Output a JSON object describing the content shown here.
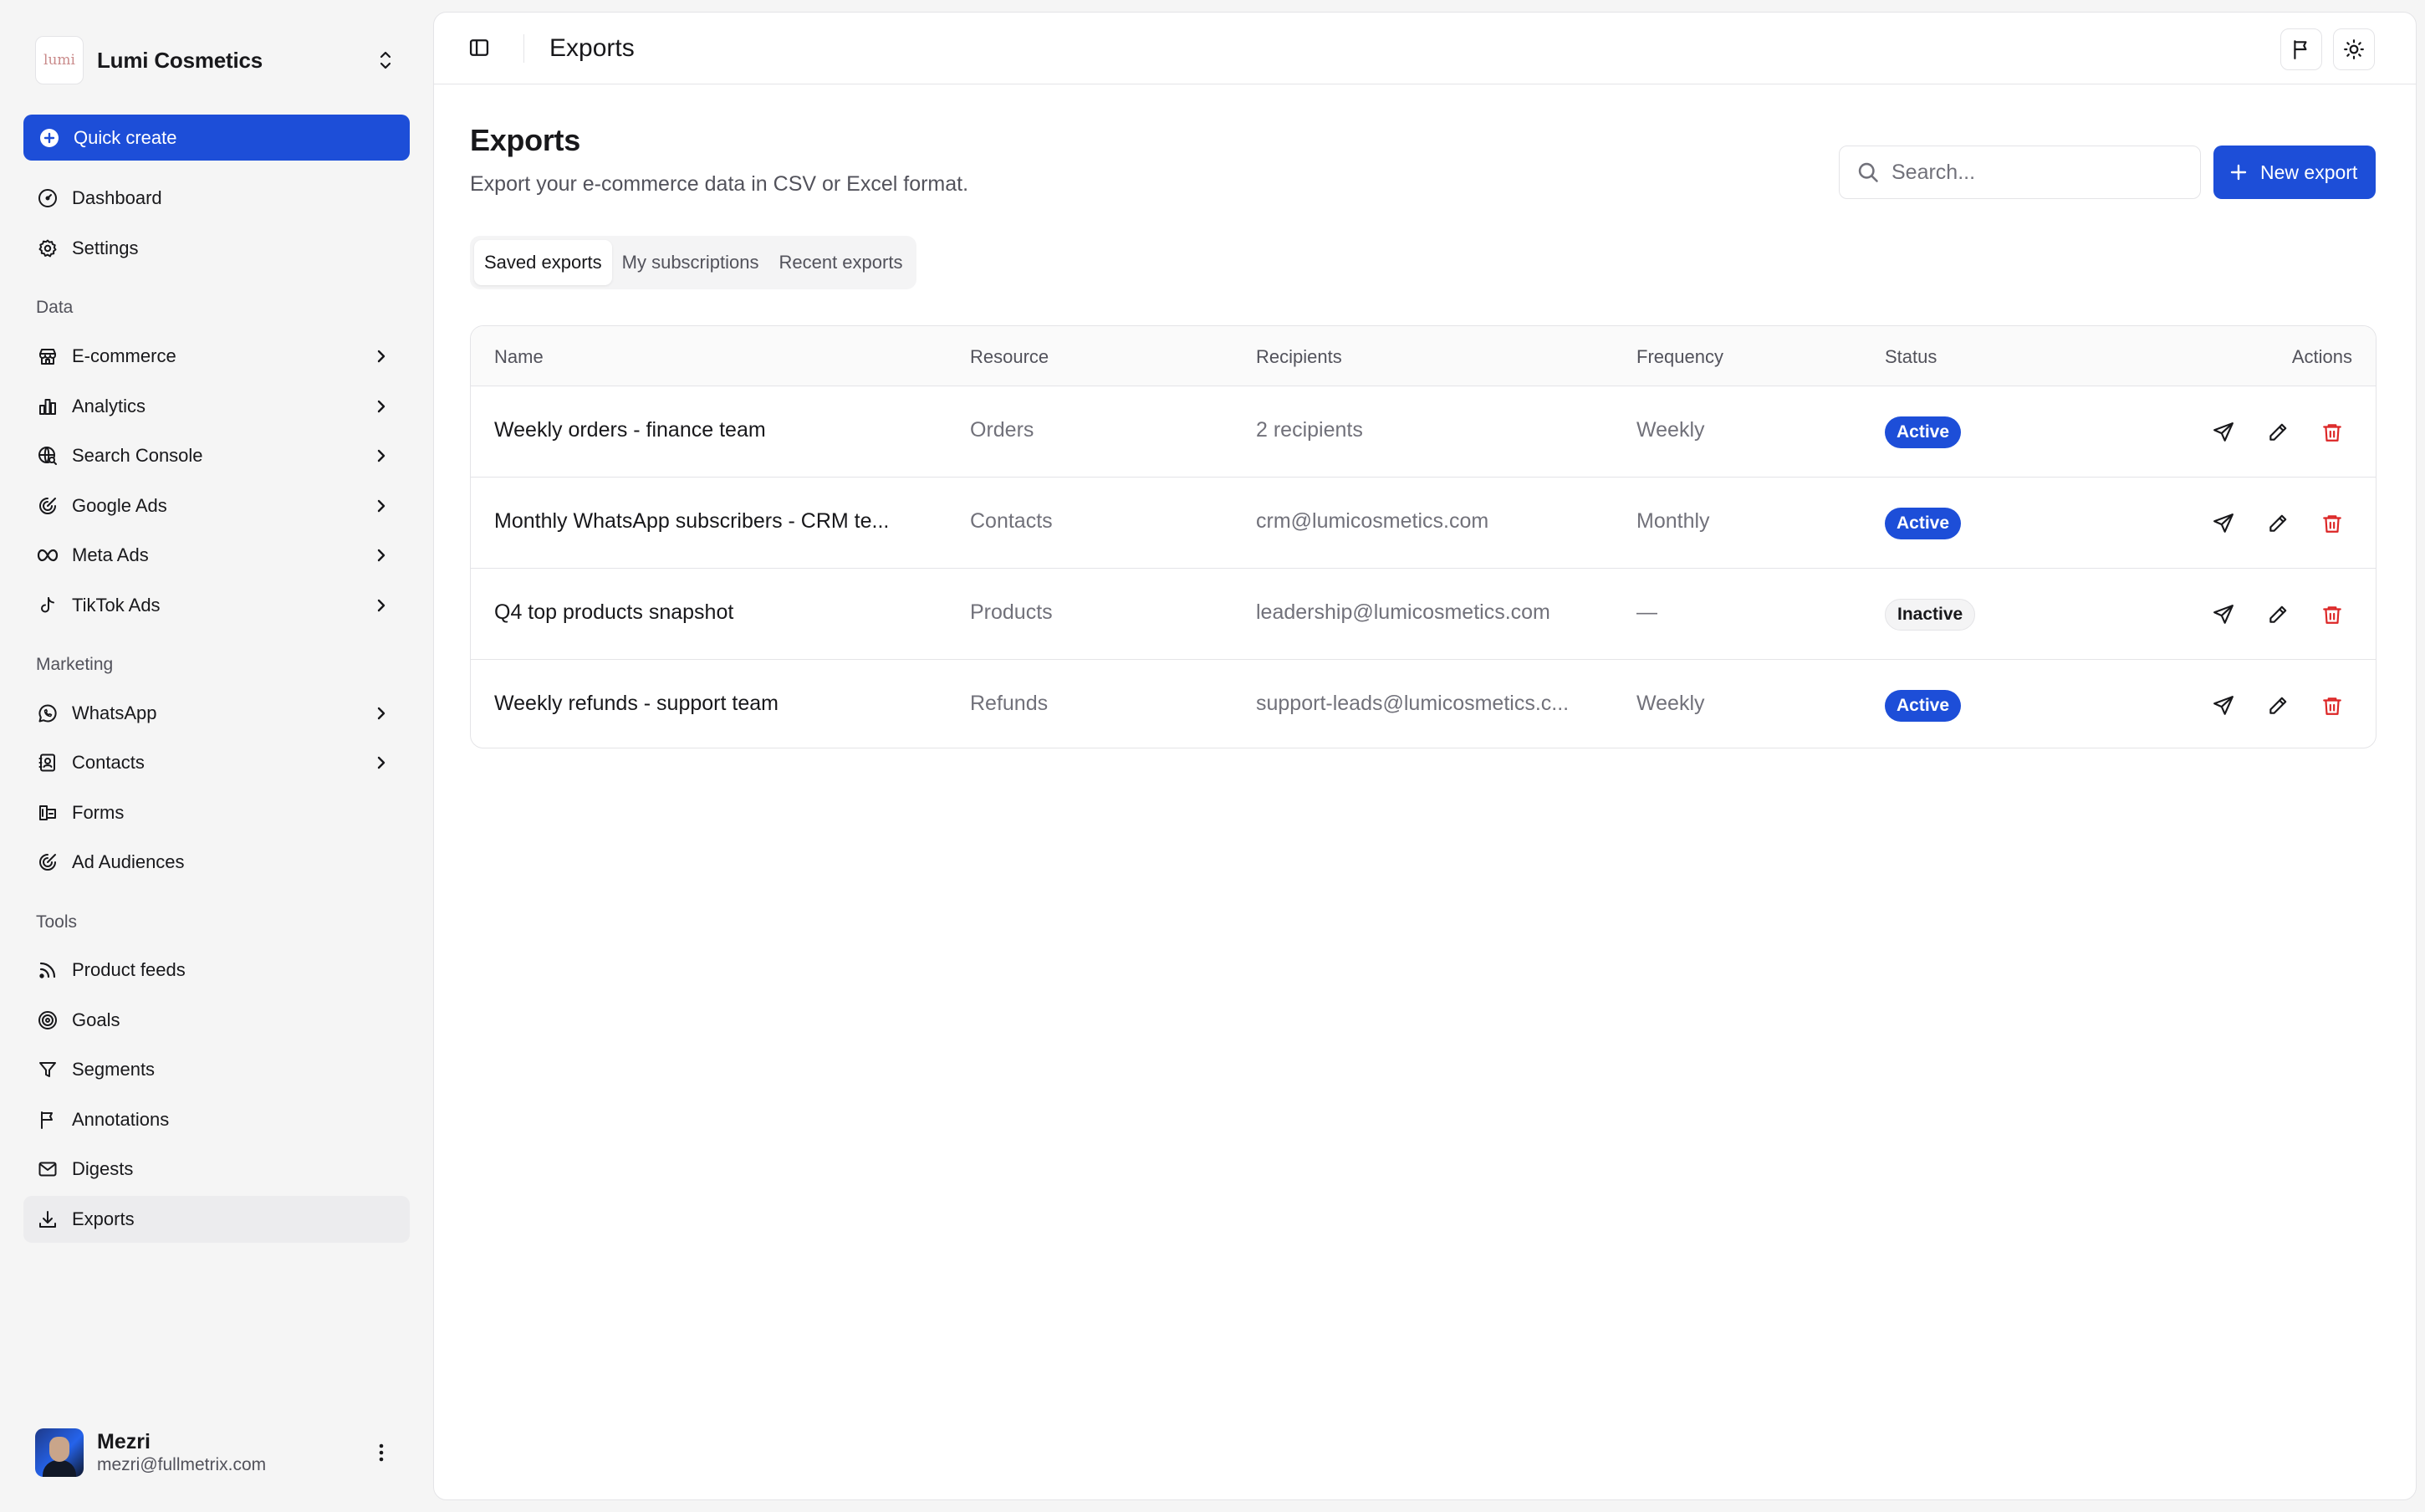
{
  "brand": {
    "logo_text": "lumi",
    "name": "Lumi Cosmetics"
  },
  "sidebar": {
    "quick_create": "Quick create",
    "top_items": [
      {
        "label": "Dashboard",
        "icon": "gauge-icon"
      },
      {
        "label": "Settings",
        "icon": "gear-icon"
      }
    ],
    "sections": [
      {
        "label": "Data",
        "items": [
          {
            "label": "E-commerce",
            "icon": "store-icon",
            "expandable": true
          },
          {
            "label": "Analytics",
            "icon": "bar-chart-icon",
            "expandable": true
          },
          {
            "label": "Search Console",
            "icon": "globe-search-icon",
            "expandable": true
          },
          {
            "label": "Google Ads",
            "icon": "target-icon",
            "expandable": true
          },
          {
            "label": "Meta Ads",
            "icon": "infinity-icon",
            "expandable": true
          },
          {
            "label": "TikTok Ads",
            "icon": "music-note-icon",
            "expandable": true
          }
        ]
      },
      {
        "label": "Marketing",
        "items": [
          {
            "label": "WhatsApp",
            "icon": "chat-bubble-icon",
            "expandable": true
          },
          {
            "label": "Contacts",
            "icon": "contact-book-icon",
            "expandable": true
          },
          {
            "label": "Forms",
            "icon": "form-icon",
            "expandable": false
          },
          {
            "label": "Ad Audiences",
            "icon": "target-icon",
            "expandable": false
          }
        ]
      },
      {
        "label": "Tools",
        "items": [
          {
            "label": "Product feeds",
            "icon": "rss-icon",
            "expandable": false
          },
          {
            "label": "Goals",
            "icon": "goal-icon",
            "expandable": false
          },
          {
            "label": "Segments",
            "icon": "funnel-icon",
            "expandable": false
          },
          {
            "label": "Annotations",
            "icon": "flag-icon",
            "expandable": false
          },
          {
            "label": "Digests",
            "icon": "mail-icon",
            "expandable": false
          },
          {
            "label": "Exports",
            "icon": "download-icon",
            "expandable": false,
            "active": true
          }
        ]
      }
    ]
  },
  "user": {
    "name": "Mezri",
    "email": "mezri@fullmetrix.com"
  },
  "topbar": {
    "title": "Exports"
  },
  "page": {
    "title": "Exports",
    "subtitle": "Export your e-commerce data in CSV or Excel format.",
    "search_placeholder": "Search...",
    "new_export_label": "New export",
    "tabs": [
      {
        "label": "Saved exports",
        "active": true
      },
      {
        "label": "My subscriptions",
        "active": false
      },
      {
        "label": "Recent exports",
        "active": false
      }
    ]
  },
  "table": {
    "columns": [
      "Name",
      "Resource",
      "Recipients",
      "Frequency",
      "Status",
      "Actions"
    ],
    "rows": [
      {
        "name": "Weekly orders - finance team",
        "resource": "Orders",
        "recipients": "2 recipients",
        "frequency": "Weekly",
        "status": "Active"
      },
      {
        "name": "Monthly WhatsApp subscribers - CRM te...",
        "resource": "Contacts",
        "recipients": "crm@lumicosmetics.com",
        "frequency": "Monthly",
        "status": "Active"
      },
      {
        "name": "Q4 top products snapshot",
        "resource": "Products",
        "recipients": "leadership@lumicosmetics.com",
        "frequency": "—",
        "status": "Inactive"
      },
      {
        "name": "Weekly refunds - support team",
        "resource": "Refunds",
        "recipients": "support-leads@lumicosmetics.c...",
        "frequency": "Weekly",
        "status": "Active"
      }
    ]
  },
  "colors": {
    "accent": "#1d4ed8",
    "danger": "#dc2626"
  }
}
